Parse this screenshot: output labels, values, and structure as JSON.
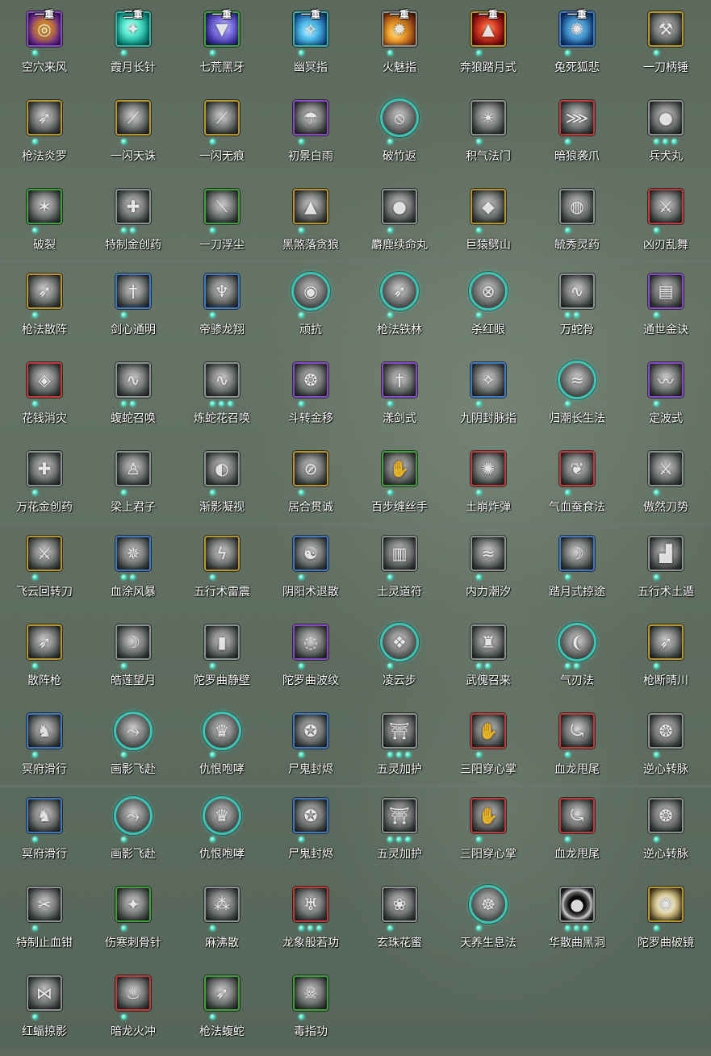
{
  "skills": [
    {
      "name": "空穴来风",
      "tier": "一重",
      "border": "purple",
      "color": "purple",
      "icon": "whirlwind-icon",
      "dots": 1,
      "shape": "square"
    },
    {
      "name": "霞月长针",
      "tier": "二重",
      "border": "teal",
      "color": "teal",
      "icon": "needle-icon",
      "dots": 1,
      "shape": "square"
    },
    {
      "name": "七荒黑牙",
      "tier": "一重",
      "border": "green",
      "color": "indigo",
      "icon": "fang-icon",
      "dots": 1,
      "shape": "square"
    },
    {
      "name": "幽冥指",
      "tier": "一重",
      "border": "teal",
      "color": "cyan",
      "icon": "finger-strike-icon",
      "dots": 1,
      "shape": "square"
    },
    {
      "name": "火魅指",
      "tier": "一重",
      "border": "gray",
      "color": "orange",
      "icon": "fire-finger-icon",
      "dots": 1,
      "shape": "square"
    },
    {
      "name": "奔狼踏月式",
      "tier": "一重",
      "border": "gold",
      "color": "red",
      "icon": "wolf-icon",
      "dots": 1,
      "shape": "square"
    },
    {
      "name": "兔死狐悲",
      "tier": "一重",
      "border": "blue",
      "color": "blue",
      "icon": "fox-icon",
      "dots": 1,
      "shape": "square"
    },
    {
      "name": "一刀柄锤",
      "tier": "",
      "border": "gold",
      "color": "gray",
      "icon": "hammer-icon",
      "dots": 1,
      "shape": "square"
    },
    {
      "name": "枪法炎罗",
      "tier": "",
      "border": "gold",
      "color": "gray",
      "icon": "spear-icon",
      "dots": 1,
      "shape": "square"
    },
    {
      "name": "一闪天诛",
      "tier": "",
      "border": "gold",
      "color": "gray",
      "icon": "flash-slash-icon",
      "dots": 1,
      "shape": "square"
    },
    {
      "name": "一闪无痕",
      "tier": "",
      "border": "gold",
      "color": "gray",
      "icon": "flash-slash-icon",
      "dots": 1,
      "shape": "square"
    },
    {
      "name": "初景白雨",
      "tier": "",
      "border": "purple",
      "color": "gray",
      "icon": "rain-icon",
      "dots": 1,
      "shape": "square"
    },
    {
      "name": "破竹返",
      "tier": "",
      "border": "teal",
      "color": "gray",
      "icon": "bamboo-icon",
      "dots": 1,
      "shape": "round"
    },
    {
      "name": "积气法门",
      "tier": "",
      "border": "gray",
      "color": "gray",
      "icon": "qi-icon",
      "dots": 1,
      "shape": "square"
    },
    {
      "name": "暗狼袭爪",
      "tier": "",
      "border": "red",
      "color": "gray",
      "icon": "claw-icon",
      "dots": 1,
      "shape": "square"
    },
    {
      "name": "兵犬丸",
      "tier": "",
      "border": "gray",
      "color": "gray",
      "icon": "pill-icon",
      "dots": 3,
      "shape": "square"
    },
    {
      "name": "破裂",
      "tier": "",
      "border": "green",
      "color": "gray",
      "icon": "shatter-icon",
      "dots": 1,
      "shape": "square"
    },
    {
      "name": "特制金创药",
      "tier": "",
      "border": "gray",
      "color": "gray",
      "icon": "medicine-icon",
      "dots": 2,
      "shape": "square"
    },
    {
      "name": "一刀浮尘",
      "tier": "",
      "border": "green",
      "color": "gray",
      "icon": "slash-icon",
      "dots": 1,
      "shape": "square"
    },
    {
      "name": "黑煞落贪狼",
      "tier": "",
      "border": "gold",
      "color": "gray",
      "icon": "wolf-icon",
      "dots": 1,
      "shape": "square"
    },
    {
      "name": "麝鹿续命丸",
      "tier": "",
      "border": "gray",
      "color": "gray",
      "icon": "pill-icon",
      "dots": 1,
      "shape": "square"
    },
    {
      "name": "巨猿劈山",
      "tier": "",
      "border": "gold",
      "color": "gray",
      "icon": "ape-icon",
      "dots": 1,
      "shape": "square"
    },
    {
      "name": "毓秀灵药",
      "tier": "",
      "border": "gray",
      "color": "gray",
      "icon": "gourd-icon",
      "dots": 1,
      "shape": "square"
    },
    {
      "name": "凶刃乱舞",
      "tier": "",
      "border": "red",
      "color": "gray",
      "icon": "blade-icon",
      "dots": 1,
      "shape": "square"
    },
    {
      "name": "枪法散阵",
      "tier": "",
      "border": "gold",
      "color": "gray",
      "icon": "spear-icon",
      "dots": 1,
      "shape": "square"
    },
    {
      "name": "剑心通明",
      "tier": "",
      "border": "blue",
      "color": "gray",
      "icon": "sword-icon",
      "dots": 1,
      "shape": "square"
    },
    {
      "name": "帝骖龙翔",
      "tier": "",
      "border": "blue",
      "color": "gray",
      "icon": "dragon-icon",
      "dots": 1,
      "shape": "square"
    },
    {
      "name": "顽抗",
      "tier": "",
      "border": "teal",
      "color": "gray",
      "icon": "resist-icon",
      "dots": 1,
      "shape": "round"
    },
    {
      "name": "枪法铁林",
      "tier": "",
      "border": "teal",
      "color": "gray",
      "icon": "spear-icon",
      "dots": 1,
      "shape": "round"
    },
    {
      "name": "杀红眼",
      "tier": "",
      "border": "teal",
      "color": "gray",
      "icon": "rage-icon",
      "dots": 1,
      "shape": "round"
    },
    {
      "name": "万蛇骨",
      "tier": "",
      "border": "gray",
      "color": "gray",
      "icon": "snake-icon",
      "dots": 2,
      "shape": "square"
    },
    {
      "name": "通世金诀",
      "tier": "",
      "border": "purple",
      "color": "gray",
      "icon": "scroll-icon",
      "dots": 1,
      "shape": "square"
    },
    {
      "name": "花钱消灾",
      "tier": "",
      "border": "red",
      "color": "gray",
      "icon": "coin-icon",
      "dots": 1,
      "shape": "square"
    },
    {
      "name": "蝮蛇召唤",
      "tier": "",
      "border": "gray",
      "color": "gray",
      "icon": "snake-icon",
      "dots": 2,
      "shape": "square"
    },
    {
      "name": "炼蛇花召唤",
      "tier": "",
      "border": "gray",
      "color": "gray",
      "icon": "snake-icon",
      "dots": 3,
      "shape": "square"
    },
    {
      "name": "斗转金移",
      "tier": "",
      "border": "purple",
      "color": "gray",
      "icon": "swirl-icon",
      "dots": 1,
      "shape": "square"
    },
    {
      "name": "漾剑式",
      "tier": "",
      "border": "purple",
      "color": "gray",
      "icon": "sword-icon",
      "dots": 1,
      "shape": "square"
    },
    {
      "name": "九阴封脉指",
      "tier": "",
      "border": "blue",
      "color": "gray",
      "icon": "finger-strike-icon",
      "dots": 1,
      "shape": "square"
    },
    {
      "name": "归潮长生法",
      "tier": "",
      "border": "teal",
      "color": "gray",
      "icon": "tide-icon",
      "dots": 1,
      "shape": "round"
    },
    {
      "name": "定波式",
      "tier": "",
      "border": "purple",
      "color": "gray",
      "icon": "wave-icon",
      "dots": 1,
      "shape": "square"
    },
    {
      "name": "万花金创药",
      "tier": "",
      "border": "gray",
      "color": "gray",
      "icon": "medicine-icon",
      "dots": 1,
      "shape": "square"
    },
    {
      "name": "梁上君子",
      "tier": "",
      "border": "gray",
      "color": "gray",
      "icon": "thief-icon",
      "dots": 1,
      "shape": "square"
    },
    {
      "name": "渐影凝视",
      "tier": "",
      "border": "gray",
      "color": "gray",
      "icon": "gaze-icon",
      "dots": 1,
      "shape": "square"
    },
    {
      "name": "居合贯诚",
      "tier": "",
      "border": "gold",
      "color": "gray",
      "icon": "iai-icon",
      "dots": 1,
      "shape": "square"
    },
    {
      "name": "百步缠丝手",
      "tier": "",
      "border": "green",
      "color": "gray",
      "icon": "hand-icon",
      "dots": 1,
      "shape": "square"
    },
    {
      "name": "土崩炸弹",
      "tier": "",
      "border": "red",
      "color": "gray",
      "icon": "bomb-icon",
      "dots": 1,
      "shape": "square"
    },
    {
      "name": "气血蚕食法",
      "tier": "",
      "border": "red",
      "color": "gray",
      "icon": "drain-icon",
      "dots": 1,
      "shape": "square"
    },
    {
      "name": "傲然刀势",
      "tier": "",
      "border": "gray",
      "color": "gray",
      "icon": "blade-icon",
      "dots": 1,
      "shape": "square"
    },
    {
      "name": "飞云回转刀",
      "tier": "",
      "border": "gold",
      "color": "gray",
      "icon": "blade-icon",
      "dots": 1,
      "shape": "square"
    },
    {
      "name": "血涂风暴",
      "tier": "",
      "border": "blue",
      "color": "gray",
      "icon": "storm-icon",
      "dots": 2,
      "shape": "square"
    },
    {
      "name": "五行术雷震",
      "tier": "",
      "border": "gold",
      "color": "gray",
      "icon": "thunder-icon",
      "dots": 1,
      "shape": "square"
    },
    {
      "name": "阴阳术退散",
      "tier": "",
      "border": "blue",
      "color": "gray",
      "icon": "yinyang-icon",
      "dots": 1,
      "shape": "square"
    },
    {
      "name": "土灵道符",
      "tier": "",
      "border": "gray",
      "color": "gray",
      "icon": "talisman-icon",
      "dots": 1,
      "shape": "square"
    },
    {
      "name": "内力潮汐",
      "tier": "",
      "border": "gray",
      "color": "gray",
      "icon": "tide-icon",
      "dots": 1,
      "shape": "square"
    },
    {
      "name": "踏月式掠途",
      "tier": "",
      "border": "blue",
      "color": "gray",
      "icon": "moon-icon",
      "dots": 1,
      "shape": "square"
    },
    {
      "name": "五行术土遁",
      "tier": "",
      "border": "gray",
      "color": "gray",
      "icon": "earth-icon",
      "dots": 1,
      "shape": "square"
    },
    {
      "name": "散阵枪",
      "tier": "",
      "border": "gold",
      "color": "gray",
      "icon": "spear-icon",
      "dots": 1,
      "shape": "square"
    },
    {
      "name": "皓莲望月",
      "tier": "",
      "border": "gray",
      "color": "gray",
      "icon": "moon-icon",
      "dots": 1,
      "shape": "square"
    },
    {
      "name": "陀罗曲静壁",
      "tier": "",
      "border": "gray",
      "color": "gray",
      "icon": "wall-icon",
      "dots": 1,
      "shape": "square"
    },
    {
      "name": "陀罗曲波纹",
      "tier": "",
      "border": "purple",
      "color": "gray",
      "icon": "ripple-icon",
      "dots": 1,
      "shape": "square"
    },
    {
      "name": "凌云步",
      "tier": "",
      "border": "teal",
      "color": "gray",
      "icon": "step-icon",
      "dots": 1,
      "shape": "round"
    },
    {
      "name": "武傀召来",
      "tier": "",
      "border": "gray",
      "color": "gray",
      "icon": "puppet-icon",
      "dots": 2,
      "shape": "square"
    },
    {
      "name": "气刃法",
      "tier": "",
      "border": "teal",
      "color": "gray",
      "icon": "air-blade-icon",
      "dots": 2,
      "shape": "round"
    },
    {
      "name": "枪断晴川",
      "tier": "",
      "border": "gold",
      "color": "gray",
      "icon": "spear-icon",
      "dots": 1,
      "shape": "square"
    },
    {
      "name": "冥府滑行",
      "tier": "",
      "border": "blue",
      "color": "gray",
      "icon": "glide-icon",
      "dots": 1,
      "shape": "square"
    },
    {
      "name": "画影飞赴",
      "tier": "",
      "border": "teal",
      "color": "gray",
      "icon": "dash-icon",
      "dots": 1,
      "shape": "round"
    },
    {
      "name": "仇恨咆哮",
      "tier": "",
      "border": "teal",
      "color": "gray",
      "icon": "roar-icon",
      "dots": 1,
      "shape": "round"
    },
    {
      "name": "尸鬼封烬",
      "tier": "",
      "border": "blue",
      "color": "gray",
      "icon": "ghost-icon",
      "dots": 1,
      "shape": "square"
    },
    {
      "name": "五灵加护",
      "tier": "",
      "border": "gray",
      "color": "gray",
      "icon": "shrine-icon",
      "dots": 3,
      "shape": "square"
    },
    {
      "name": "三阳穿心掌",
      "tier": "",
      "border": "red",
      "color": "gray",
      "icon": "palm-icon",
      "dots": 1,
      "shape": "square"
    },
    {
      "name": "血龙甩尾",
      "tier": "",
      "border": "red",
      "color": "gray",
      "icon": "dragon-tail-icon",
      "dots": 1,
      "shape": "square"
    },
    {
      "name": "逆心转脉",
      "tier": "",
      "border": "gray",
      "color": "gray",
      "icon": "swirl-icon",
      "dots": 1,
      "shape": "square"
    },
    {
      "name": "冥府滑行",
      "tier": "",
      "border": "blue",
      "color": "gray",
      "icon": "glide-icon",
      "dots": 1,
      "shape": "square"
    },
    {
      "name": "画影飞赴",
      "tier": "",
      "border": "teal",
      "color": "gray",
      "icon": "dash-icon",
      "dots": 1,
      "shape": "round"
    },
    {
      "name": "仇恨咆哮",
      "tier": "",
      "border": "teal",
      "color": "gray",
      "icon": "roar-icon",
      "dots": 1,
      "shape": "round"
    },
    {
      "name": "尸鬼封烬",
      "tier": "",
      "border": "blue",
      "color": "gray",
      "icon": "ghost-icon",
      "dots": 1,
      "shape": "square"
    },
    {
      "name": "五灵加护",
      "tier": "",
      "border": "gray",
      "color": "gray",
      "icon": "shrine-icon",
      "dots": 3,
      "shape": "square"
    },
    {
      "name": "三阳穿心掌",
      "tier": "",
      "border": "red",
      "color": "gray",
      "icon": "palm-icon",
      "dots": 1,
      "shape": "square"
    },
    {
      "name": "血龙甩尾",
      "tier": "",
      "border": "red",
      "color": "gray",
      "icon": "dragon-tail-icon",
      "dots": 1,
      "shape": "square"
    },
    {
      "name": "逆心转脉",
      "tier": "",
      "border": "gray",
      "color": "gray",
      "icon": "swirl-icon",
      "dots": 1,
      "shape": "square"
    },
    {
      "name": "特制止血钳",
      "tier": "",
      "border": "gray",
      "color": "gray",
      "icon": "clamp-icon",
      "dots": 1,
      "shape": "square"
    },
    {
      "name": "伤寒刺骨针",
      "tier": "",
      "border": "green",
      "color": "gray",
      "icon": "needle-icon",
      "dots": 1,
      "shape": "square"
    },
    {
      "name": "麻沸散",
      "tier": "",
      "border": "gray",
      "color": "gray",
      "icon": "powder-icon",
      "dots": 1,
      "shape": "square"
    },
    {
      "name": "龙象般若功",
      "tier": "",
      "border": "red",
      "color": "gray",
      "icon": "elephant-icon",
      "dots": 3,
      "shape": "square"
    },
    {
      "name": "玄珠花蜜",
      "tier": "",
      "border": "gray",
      "color": "gray",
      "icon": "nectar-icon",
      "dots": 1,
      "shape": "square"
    },
    {
      "name": "天养生息法",
      "tier": "",
      "border": "teal",
      "color": "gray",
      "icon": "meditate-icon",
      "dots": 1,
      "shape": "round"
    },
    {
      "name": "华散曲黑洞",
      "tier": "",
      "border": "gray",
      "color": "black",
      "icon": "black-hole-icon",
      "dots": 3,
      "shape": "square"
    },
    {
      "name": "陀罗曲破镜",
      "tier": "",
      "border": "gold",
      "color": "halo",
      "icon": "mirror-icon",
      "dots": 1,
      "shape": "square"
    },
    {
      "name": "红蝠掠影",
      "tier": "",
      "border": "gray",
      "color": "gray",
      "icon": "bat-icon",
      "dots": 1,
      "shape": "square"
    },
    {
      "name": "暗龙火冲",
      "tier": "",
      "border": "red",
      "color": "gray",
      "icon": "fire-icon",
      "dots": 1,
      "shape": "square"
    },
    {
      "name": "枪法蝮蛇",
      "tier": "",
      "border": "green",
      "color": "gray",
      "icon": "spear-icon",
      "dots": 1,
      "shape": "square"
    },
    {
      "name": "毒指功",
      "tier": "",
      "border": "green",
      "color": "gray",
      "icon": "poison-finger-icon",
      "dots": 1,
      "shape": "square"
    }
  ],
  "glyphs": {
    "whirlwind-icon": "◎",
    "needle-icon": "✦",
    "fang-icon": "▼",
    "finger-strike-icon": "✧",
    "fire-finger-icon": "✹",
    "wolf-icon": "▲",
    "fox-icon": "✺",
    "hammer-icon": "⚒",
    "spear-icon": "➶",
    "flash-slash-icon": "⟋",
    "rain-icon": "☂",
    "bamboo-icon": "⦸",
    "qi-icon": "✴",
    "claw-icon": "⋙",
    "pill-icon": "●",
    "shatter-icon": "✶",
    "medicine-icon": "✚",
    "slash-icon": "⟍",
    "ape-icon": "◆",
    "gourd-icon": "◍",
    "blade-icon": "⚔",
    "sword-icon": "†",
    "dragon-icon": "♆",
    "resist-icon": "◉",
    "rage-icon": "⊗",
    "snake-icon": "∿",
    "scroll-icon": "▤",
    "coin-icon": "◈",
    "swirl-icon": "❂",
    "tide-icon": "≈",
    "wave-icon": "〰",
    "thief-icon": "♙",
    "gaze-icon": "◐",
    "iai-icon": "⊘",
    "hand-icon": "✋",
    "bomb-icon": "✺",
    "drain-icon": "❦",
    "storm-icon": "✵",
    "thunder-icon": "ϟ",
    "yinyang-icon": "☯",
    "talisman-icon": "▥",
    "moon-icon": "☽",
    "earth-icon": "▟",
    "wall-icon": "▮",
    "ripple-icon": "◌",
    "step-icon": "❖",
    "puppet-icon": "♜",
    "air-blade-icon": "❨",
    "glide-icon": "♞",
    "dash-icon": "⤳",
    "roar-icon": "♛",
    "ghost-icon": "✪",
    "shrine-icon": "⛩",
    "palm-icon": "✋",
    "dragon-tail-icon": "⤿",
    "clamp-icon": "✂",
    "powder-icon": "⁂",
    "elephant-icon": "♅",
    "nectar-icon": "❀",
    "meditate-icon": "☸",
    "black-hole-icon": "●",
    "mirror-icon": "✺",
    "bat-icon": "⋈",
    "fire-icon": "♨",
    "poison-finger-icon": "☠"
  }
}
